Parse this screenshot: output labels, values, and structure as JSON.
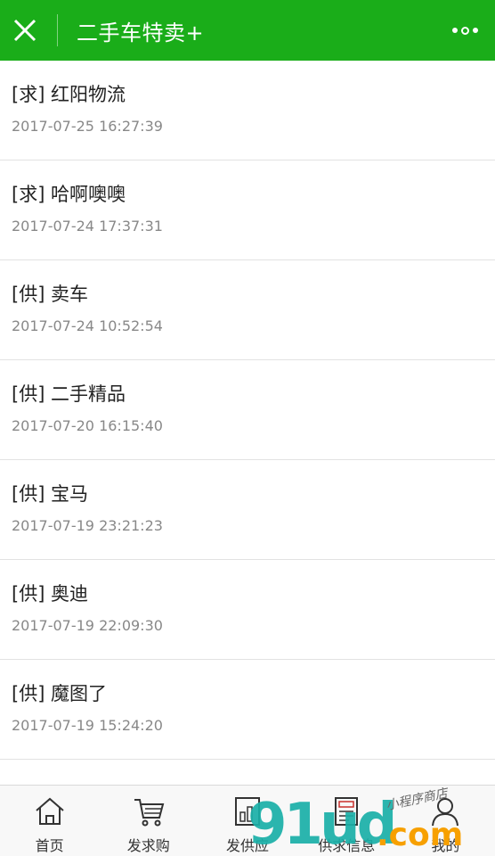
{
  "navbar": {
    "title": "二手车特卖+",
    "background": "#1aad19"
  },
  "list": {
    "items": [
      {
        "title": "[求] 红阳物流",
        "time": "2017-07-25 16:27:39"
      },
      {
        "title": "[求] 哈啊噢噢",
        "time": "2017-07-24 17:37:31"
      },
      {
        "title": "[供] 卖车",
        "time": "2017-07-24 10:52:54"
      },
      {
        "title": "[供] 二手精品",
        "time": "2017-07-20 16:15:40"
      },
      {
        "title": "[供] 宝马",
        "time": "2017-07-19 23:21:23"
      },
      {
        "title": "[供] 奥迪",
        "time": "2017-07-19 22:09:30"
      },
      {
        "title": "[供] 魔图了",
        "time": "2017-07-19 15:24:20"
      },
      {
        "title": "",
        "time": ""
      }
    ]
  },
  "tabbar": {
    "tabs": [
      {
        "label": "首页",
        "icon": "home-icon"
      },
      {
        "label": "发求购",
        "icon": "cart-icon"
      },
      {
        "label": "发供应",
        "icon": "supply-icon"
      },
      {
        "label": "供求信息",
        "icon": "info-icon"
      },
      {
        "label": "我的",
        "icon": "user-icon"
      }
    ]
  },
  "watermark": {
    "main": "91ud",
    "suffix": ".com",
    "small": "小程序商店"
  }
}
